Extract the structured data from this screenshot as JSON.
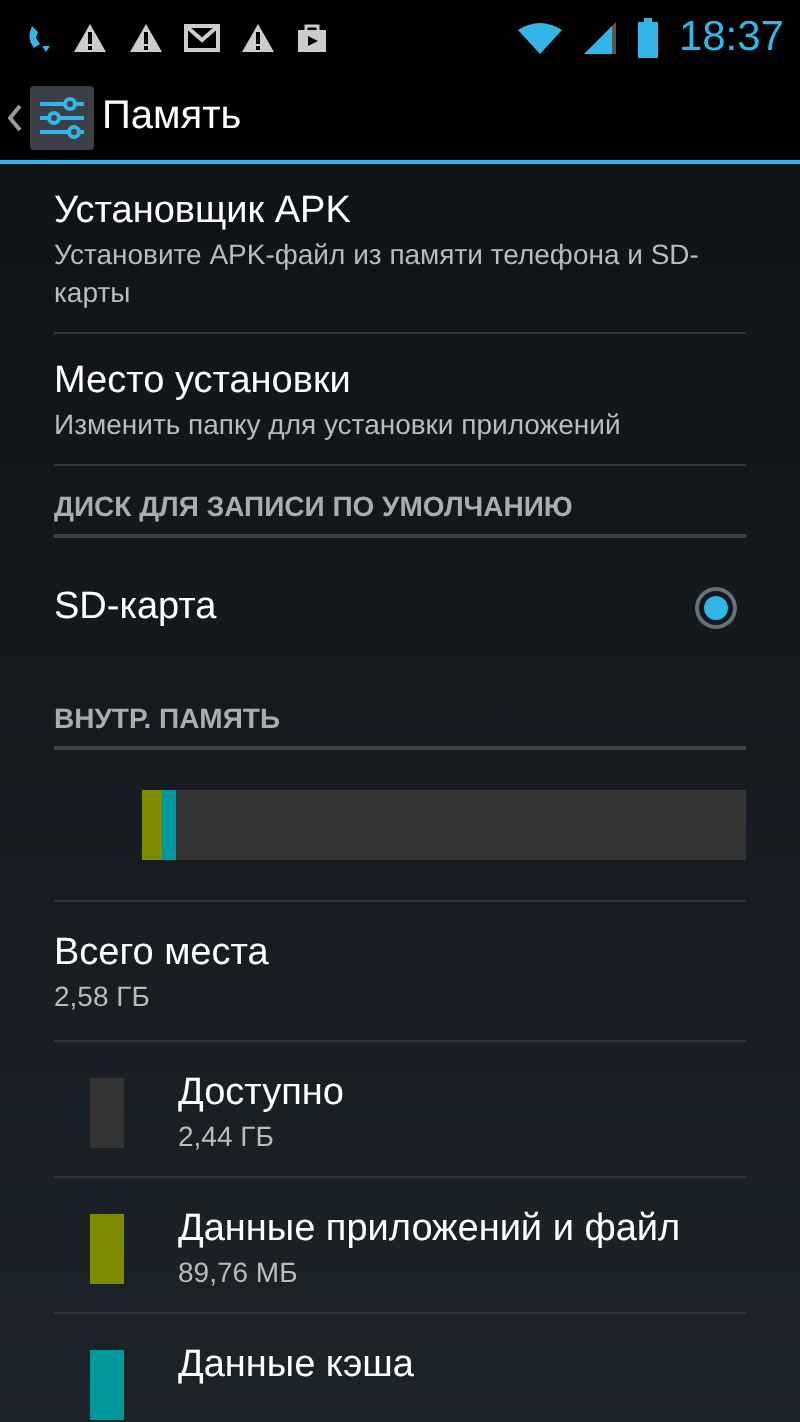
{
  "status_bar": {
    "time": "18:37"
  },
  "action_bar": {
    "title": "Память"
  },
  "items": [
    {
      "title": "Установщик APK",
      "subtitle": "Установите APK-файл из памяти телефона и SD-карты"
    },
    {
      "title": "Место установки",
      "subtitle": "Изменить папку для установки приложений"
    }
  ],
  "default_disk": {
    "header": "ДИСК ДЛЯ ЗАПИСИ ПО УМОЛЧАНИЮ",
    "options": [
      {
        "label": "SD-карта",
        "selected": true
      }
    ]
  },
  "internal": {
    "header": "ВНУТР. ПАМЯТЬ",
    "total": {
      "title": "Всего места",
      "value": "2,58 ГБ"
    },
    "categories": [
      {
        "title": "Доступно",
        "value": "2,44 ГБ",
        "color": "#333333"
      },
      {
        "title": "Данные приложений и файл",
        "value": "89,76 МБ",
        "color": "#7f8c00",
        "level": 0.033
      },
      {
        "title": "Данные кэша",
        "color": "#00999b",
        "level": 0.023
      }
    ]
  }
}
